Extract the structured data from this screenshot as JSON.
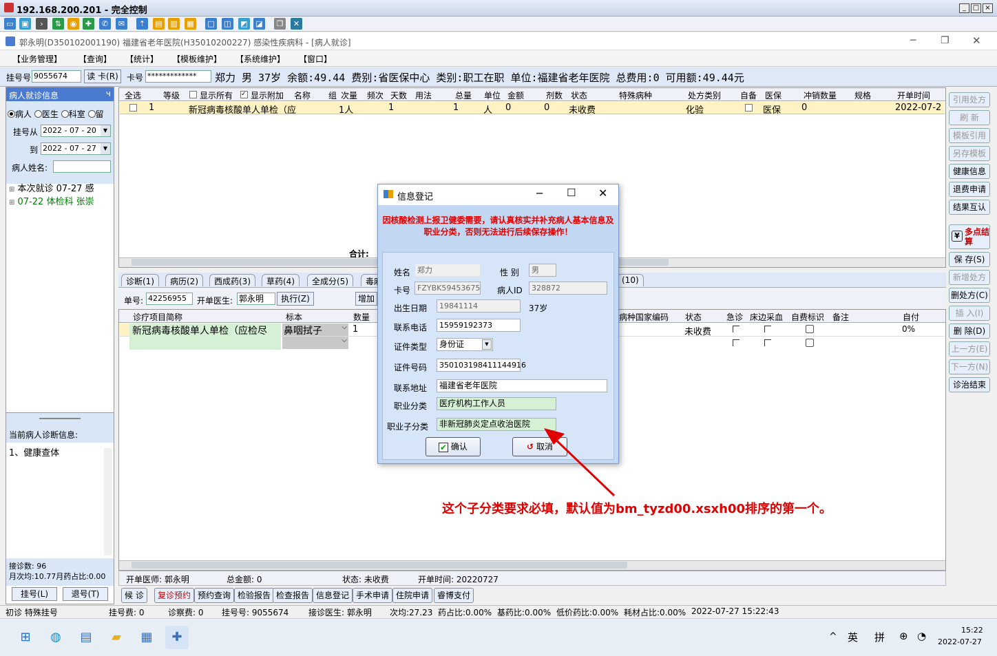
{
  "remote": {
    "title": "192.168.200.201 - 完全控制"
  },
  "app": {
    "title": "郭永明(D350102001190) 福建省老年医院(H35010200227) 感染性疾病科 - [病人就诊]"
  },
  "menu": [
    "【业务管理】",
    "【查询】",
    "【统计】",
    "【模板维护】",
    "【系统维护】",
    "【窗口】"
  ],
  "patient_bar": {
    "reg_label": "挂号号",
    "reg_no": "9055674",
    "read_card": "读 卡(R)",
    "card_label": "卡号",
    "card_no": "*************",
    "info": "郑力 男 37岁 余额:49.44 费别:省医保中心 类别:职工在职 单位:福建省老年医院 总费用:0 可用额:49.44元"
  },
  "left": {
    "header": "病人就诊信息",
    "pin": "ч",
    "radio_patient": "病人",
    "radio_doctor": "医生",
    "radio_dept": "科室",
    "radio_stay": "留",
    "from_label": "挂号从",
    "from_date": "2022 - 07 - 20",
    "to_label": "到",
    "to_date": "2022 - 07 - 27",
    "name_label": "病人姓名:",
    "tree": [
      {
        "text": "本次就诊 07-27 感",
        "color": "#000000"
      },
      {
        "text": "07-22 体检科 张崇",
        "color": "#008000"
      }
    ],
    "diag_header": "当前病人诊断信息:",
    "diag_item": "1、健康查体",
    "stats1": "接诊数: 96",
    "stats2": "月次均:10.77月药占比:0.00",
    "btn_reg": "挂号(L)",
    "btn_return": "退号(T)"
  },
  "main_grid": {
    "headers": [
      "全选",
      "等级",
      "显示所有",
      "显示附加",
      "名称",
      "组",
      "次量",
      "频次",
      "天数",
      "用法",
      "总量",
      "单位",
      "金额",
      "剂数",
      "状态",
      "特殊病种",
      "处方类别",
      "自备",
      "医保",
      "冲销数量",
      "规格",
      "开单时间"
    ],
    "row": {
      "level": "1",
      "name": "新冠病毒核酸单人单检（应",
      "dose": "1人",
      "days": "1",
      "total": "1",
      "unit": "人",
      "amount": "0",
      "count": "0",
      "status": "未收费",
      "category": "化验",
      "insurance": "医保",
      "offset": "0",
      "time": "2022-07-2"
    },
    "sum_label": "合计:"
  },
  "tabs": [
    "诊断(1)",
    "病历(2)",
    "西成药(3)",
    "草药(4)",
    "全成分(5)",
    "毒麻",
    "(10)"
  ],
  "order_bar": {
    "no_label": "单号:",
    "no": "42256955",
    "doctor_label": "开单医生:",
    "doctor": "郭永明",
    "exec": "执行(Z)",
    "add": "增加"
  },
  "sub_grid": {
    "headers": [
      "诊疗项目简称",
      "标本",
      "数量",
      "病种国家编码",
      "状态",
      "急诊",
      "床边采血",
      "自费标识",
      "备注",
      "自付"
    ],
    "row": {
      "name": "新冠病毒核酸单人单检（应检尽",
      "specimen": "鼻咽拭子",
      "qty": "1",
      "status": "未收费",
      "pay": "0%"
    }
  },
  "right_buttons": [
    {
      "label": "引用处方",
      "disabled": true
    },
    {
      "label": "刷 新",
      "disabled": true
    },
    {
      "label": "模板引用",
      "disabled": true
    },
    {
      "label": "另存模板",
      "disabled": true
    },
    {
      "label": "健康信息",
      "disabled": false
    },
    {
      "label": "退费申请",
      "disabled": false
    },
    {
      "label": "结果互认",
      "disabled": false
    },
    {
      "label": "多点结算",
      "disabled": false
    },
    {
      "label": "保 存(S)",
      "disabled": false
    },
    {
      "label": "新增处方",
      "disabled": true
    },
    {
      "label": "删处方(C)",
      "disabled": false
    },
    {
      "label": "插 入(I)",
      "disabled": true
    },
    {
      "label": "删 除(D)",
      "disabled": false
    },
    {
      "label": "上一方(E)",
      "disabled": true
    },
    {
      "label": "下一方(N)",
      "disabled": true
    },
    {
      "label": "诊治结束",
      "disabled": false
    }
  ],
  "bottom_info": {
    "doctor": "开单医师: 郭永明",
    "total": "总金额: 0",
    "status": "状态: 未收费",
    "time": "开单时间: 20220727"
  },
  "bottom_buttons": [
    "候 诊",
    "复诊预约",
    "预约查询",
    "检验报告",
    "检查报告",
    "信息登记",
    "手术申请",
    "住院申请",
    "睿博支付"
  ],
  "status_bar": {
    "text1": "初诊 特殊挂号",
    "text2": "挂号费: 0",
    "text3": "诊察费: 0",
    "text4": "挂号号: 9055674",
    "text5": "接诊医生: 郭永明",
    "text6": "次均:27.23",
    "text7": "药占比:0.00%",
    "text8": "基药比:0.00%",
    "text9": "低价药比:0.00%",
    "text10": "耗材占比:0.00%",
    "text11": "2022-07-27 15:22:43"
  },
  "taskbar": {
    "ime1": "英",
    "ime2": "拼",
    "time": "15:22",
    "date": "2022-07-27"
  },
  "dialog": {
    "title": "信息登记",
    "warning": "因核酸检测上报卫健委需要，请认真核实并补充病人基本信息及职业分类，否则无法进行后续保存操作！",
    "name_label": "姓名",
    "name": "郑力",
    "gender_label": "性 别",
    "gender": "男",
    "card_label": "卡号",
    "card": "FZYBK59453675",
    "pid_label": "病人ID",
    "pid": "328872",
    "birth_label": "出生日期",
    "birth": "19841114",
    "age": "37岁",
    "phone_label": "联系电话",
    "phone": "15959192373",
    "idtype_label": "证件类型",
    "idtype": "身份证",
    "idno_label": "证件号码",
    "idno": "350103198411144916",
    "addr_label": "联系地址",
    "addr": "福建省老年医院",
    "occ_label": "职业分类",
    "occ": "医疗机构工作人员",
    "subocc_label": "职业子分类",
    "subocc": "非新冠肺炎定点收治医院",
    "ok": "确认",
    "cancel": "取消"
  },
  "annotation": "这个子分类要求必填，默认值为bm_tyzd00.xsxh00排序的第一个。"
}
